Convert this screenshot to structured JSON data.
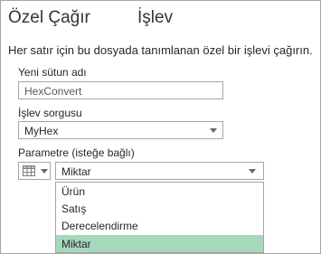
{
  "dialog": {
    "title_left": "Özel Çağır",
    "title_right": "İşlev",
    "description": "Her satır için bu dosyada tanımlanan özel bir işlevi çağırın."
  },
  "form": {
    "new_column": {
      "label": "Yeni sütun adı",
      "value": "HexConvert"
    },
    "function_query": {
      "label": "İşlev sorgusu",
      "value": "MyHex"
    },
    "parameter": {
      "label": "Parametre (isteğe bağlı)",
      "type_icon": "table-column-icon",
      "value": "Miktar",
      "options": [
        "Ürün",
        "Satış",
        "Derecelendirme",
        "Miktar"
      ],
      "selected": "Miktar"
    }
  },
  "colors": {
    "selection": "#a6d8bd",
    "border": "#a6a6a6"
  }
}
